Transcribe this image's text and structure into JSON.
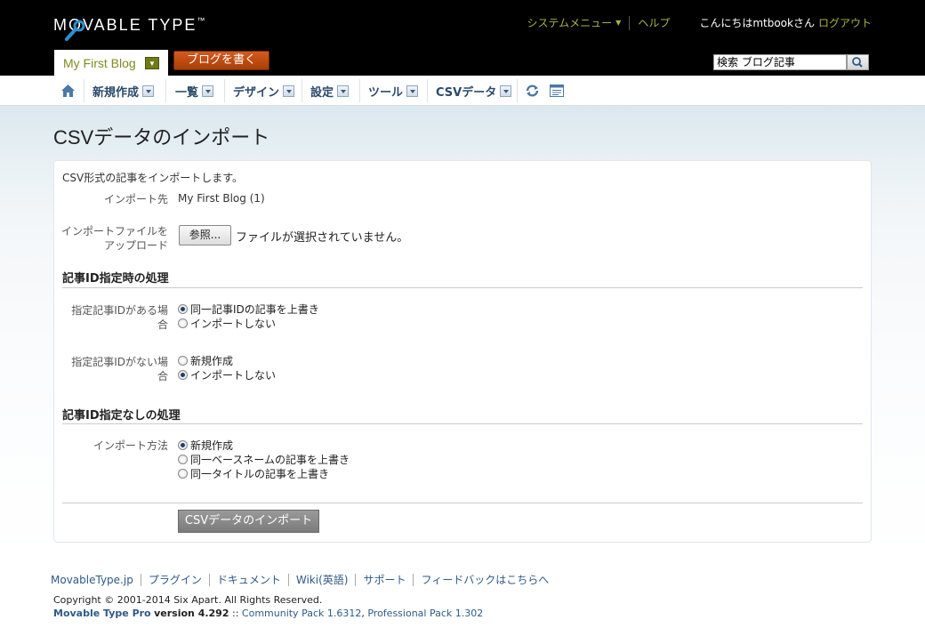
{
  "header": {
    "logo_text": "MOVABLE TYPE",
    "logo_tm": "™",
    "system_menu": "システムメニュー",
    "help": "ヘルプ",
    "greeting": "こんにちはmtbookさん",
    "logout": "ログアウト",
    "blog_name": "My First Blog",
    "write_button": "ブログを書く",
    "search_value": "検索 ブログ記事"
  },
  "nav": {
    "items": [
      {
        "label": "新規作成"
      },
      {
        "label": "一覧"
      },
      {
        "label": "デザイン"
      },
      {
        "label": "設定"
      },
      {
        "label": "ツール"
      },
      {
        "label": "CSVデータ"
      }
    ]
  },
  "page": {
    "title": "CSVデータのインポート",
    "intro": "CSV形式の記事をインポートします。",
    "import_target_label": "インポート先",
    "import_target_value": "My First Blog (1)",
    "upload_label_1": "インポートファイルを",
    "upload_label_2": "アップロード",
    "browse_button": "参照...",
    "no_file": "ファイルが選択されていません。",
    "section1_title": "記事ID指定時の処理",
    "with_id_label_1": "指定記事IDがある場",
    "with_id_label_2": "合",
    "with_id_opt1": "同一記事IDの記事を上書き",
    "with_id_opt2": "インポートしない",
    "without_id_label_1": "指定記事IDがない場",
    "without_id_label_2": "合",
    "without_id_opt1": "新規作成",
    "without_id_opt2": "インポートしない",
    "section2_title": "記事ID指定なしの処理",
    "method_label": "インポート方法",
    "method_opt1": "新規作成",
    "method_opt2": "同一ベースネームの記事を上書き",
    "method_opt3": "同一タイトルの記事を上書き",
    "submit_button": "CSVデータのインポート"
  },
  "footer": {
    "links": [
      "MovableType.jp",
      "プラグイン",
      "ドキュメント",
      "Wiki(英語)",
      "サポート",
      "フィードバックはこちらへ"
    ],
    "copyright": "Copyright © 2001-2014 Six Apart. All Rights Reserved.",
    "product": "Movable Type Pro",
    "version_word": "version 4.292",
    "sep": " :: ",
    "community_pack": "Community Pack 1.6312",
    "comma": ", ",
    "professional_pack": "Professional Pack 1.302"
  }
}
